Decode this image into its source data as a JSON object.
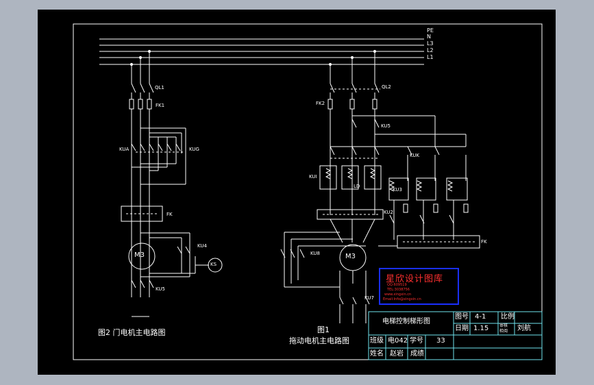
{
  "rails": [
    "PE",
    "N",
    "L3",
    "L2",
    "L1"
  ],
  "fig2": {
    "fuse_switch": "QL1",
    "fuse": "FK1",
    "contactor_left": "KUA",
    "contactor_right": "KUG",
    "thermal": "FK",
    "motor": "M3",
    "brake_contactor": "KU4",
    "brake_coil": "KS",
    "bottom_contactor": "KU5",
    "caption": "图2  门电机主电路图"
  },
  "fig1": {
    "fuse_switch": "QL2",
    "fuse": "FK2",
    "contactor_top": "KU5",
    "contactor_left": "KUI",
    "contactor_mid": "LD",
    "contactor_k": "KUK",
    "contactor_r": "KU3",
    "contactor_lower": "KU2",
    "thermal": "FK",
    "motor": "M3",
    "contactor_motor": "KU8",
    "contactor_bottom": "KU7",
    "caption_num": "图1",
    "caption": "拖动电机主电路图"
  },
  "watermark": {
    "title": "星欣设计图库",
    "line1": "QQ:609519",
    "line2": "TEL:3038756",
    "line3": "www.xingxin.cn",
    "line4": "Email:Info@xingxin.cn"
  },
  "title_block": {
    "drawing_title": "电梯控制梯形图",
    "fig_no_label": "图号",
    "fig_no": "4-1",
    "scale_label": "比例",
    "date_label": "日期",
    "date": "1.15",
    "drawn_label": "审核",
    "drawn_sub": "检阅",
    "reviewer": "刘航",
    "class_label": "班级",
    "class_value": "电042",
    "seq_label": "学号",
    "seq_value": "33",
    "name_label": "姓名",
    "name_value": "赵岩",
    "grade_label": "成绩"
  }
}
